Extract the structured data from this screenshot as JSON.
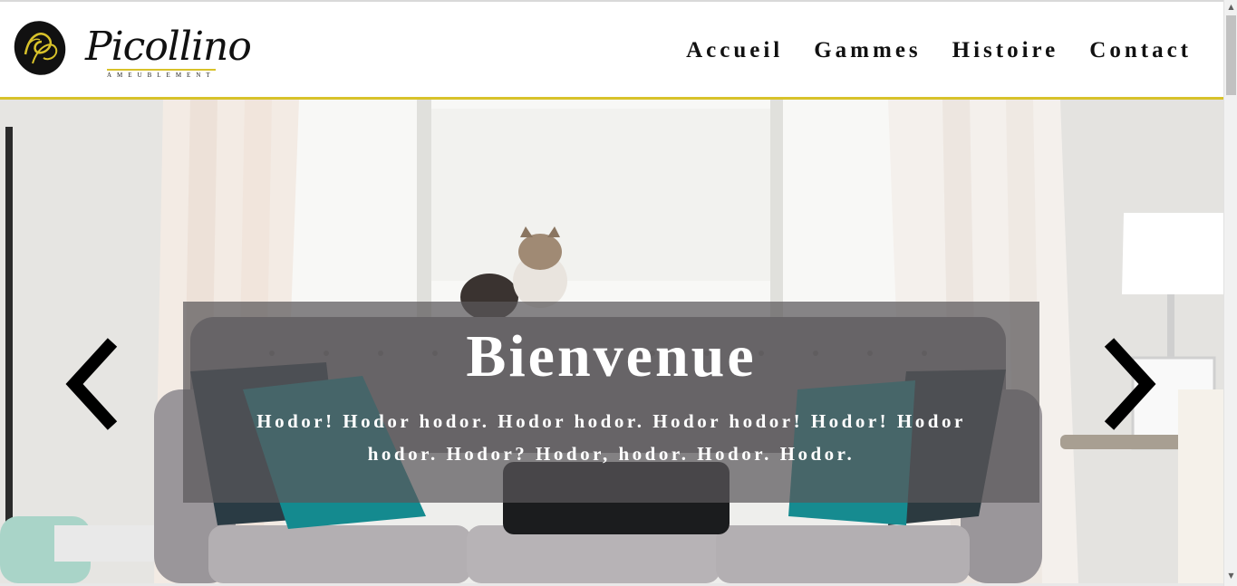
{
  "brand": {
    "name": "Picollino",
    "tagline": "AMEUBLEMENT",
    "accent_color": "#d8c22a"
  },
  "nav": {
    "items": [
      {
        "label": "Accueil"
      },
      {
        "label": "Gammes"
      },
      {
        "label": "Histoire"
      },
      {
        "label": "Contact"
      }
    ]
  },
  "hero": {
    "title": "Bienvenue",
    "text": "Hodor! Hodor hodor. Hodor hodor. Hodor hodor! Hodor! Hodor hodor. Hodor? Hodor, hodor. Hodor. Hodor.",
    "prev_icon": "chevron-left-icon",
    "next_icon": "chevron-right-icon"
  }
}
